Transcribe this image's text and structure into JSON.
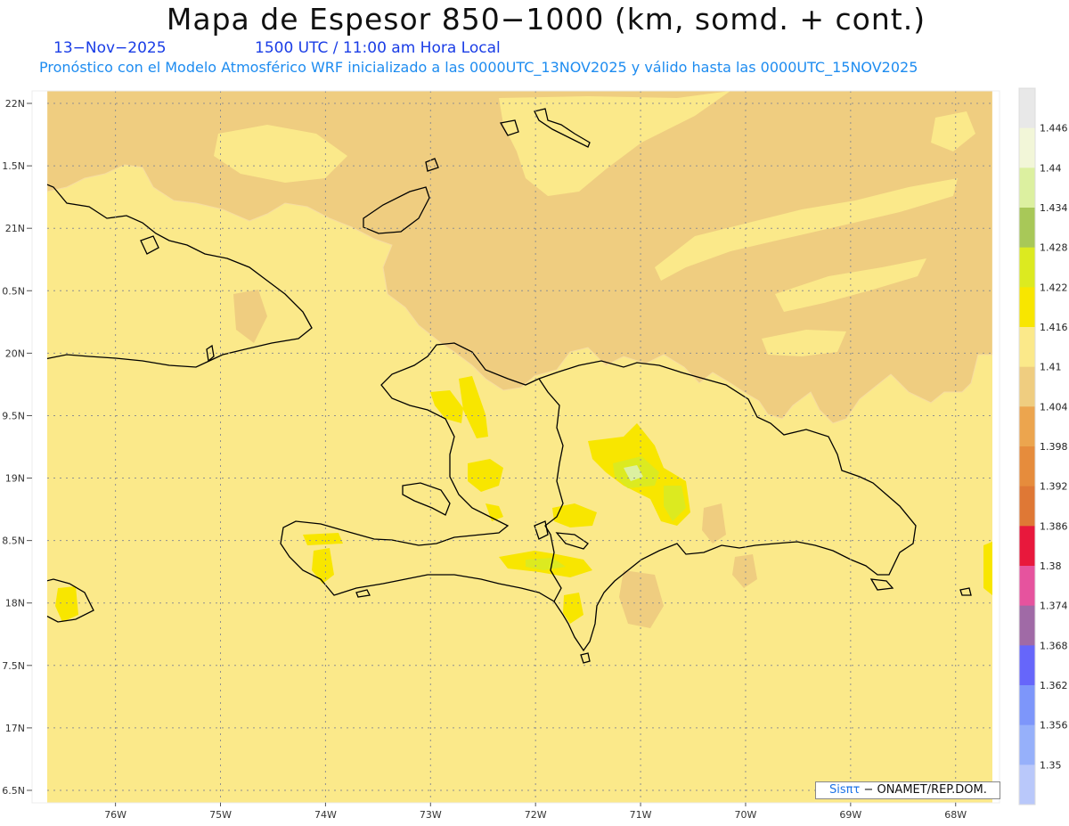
{
  "header": {
    "title": "Mapa de Espesor 850−1000 (km, somd. + cont.)",
    "date": "13−Nov−2025",
    "time": "1500 UTC / 11:00 am Hora Local",
    "info": "Pronóstico con el Modelo Atmosférico WRF inicializado a las 0000UTC_13NOV2025 y válido hasta las  0000UTC_15NOV2025"
  },
  "chart_data": {
    "type": "heatmap",
    "field": "850-1000 hPa thickness",
    "unit": "km",
    "x_range": [
      -76.65,
      -67.65
    ],
    "y_range": [
      16.4,
      22.1
    ],
    "x_ticks": [
      {
        "value": -76,
        "label": "76W"
      },
      {
        "value": -75,
        "label": "75W"
      },
      {
        "value": -74,
        "label": "74W"
      },
      {
        "value": -73,
        "label": "73W"
      },
      {
        "value": -72,
        "label": "72W"
      },
      {
        "value": -71,
        "label": "71W"
      },
      {
        "value": -70,
        "label": "70W"
      },
      {
        "value": -69,
        "label": "69W"
      },
      {
        "value": -68,
        "label": "68W"
      }
    ],
    "y_ticks": [
      {
        "value": 22,
        "label": "22N"
      },
      {
        "value": 21.5,
        "label": "1.5N"
      },
      {
        "value": 21,
        "label": "21N"
      },
      {
        "value": 20.5,
        "label": "0.5N"
      },
      {
        "value": 20,
        "label": "20N"
      },
      {
        "value": 19.5,
        "label": "9.5N"
      },
      {
        "value": 19,
        "label": "19N"
      },
      {
        "value": 18.5,
        "label": "8.5N"
      },
      {
        "value": 18,
        "label": "18N"
      },
      {
        "value": 17.5,
        "label": "7.5N"
      },
      {
        "value": 17,
        "label": "17N"
      },
      {
        "value": 16.5,
        "label": "6.5N"
      }
    ],
    "grid": true,
    "colorbar": {
      "placement": "right",
      "labels": [
        "1.446",
        "1.44",
        "1.434",
        "1.428",
        "1.422",
        "1.416",
        "1.41",
        "1.404",
        "1.398",
        "1.392",
        "1.386",
        "1.38",
        "1.374",
        "1.368",
        "1.362",
        "1.356",
        "1.35"
      ],
      "colors": [
        "#e8e8e8",
        "#f2f6d8",
        "#dcf0a0",
        "#a8c858",
        "#dcea20",
        "#f8e600",
        "#fbe98a",
        "#efcd80",
        "#eca54e",
        "#e68c3c",
        "#df7835",
        "#e8183c",
        "#e6539e",
        "#a06aa6",
        "#6666fa",
        "#7d96fa",
        "#96b0fa",
        "#b9c8fa"
      ]
    },
    "colors": {
      "main": "#fbe98a",
      "north": "#efcd80",
      "high": "#f8e600",
      "higher": "#dcea20",
      "highest": "#dcf0a0"
    },
    "contours": [
      1.404,
      1.41,
      1.416,
      1.422,
      1.428
    ]
  },
  "credit": {
    "brand": "Sisπτ",
    "rest": "− ONAMET/REP.DOM."
  }
}
